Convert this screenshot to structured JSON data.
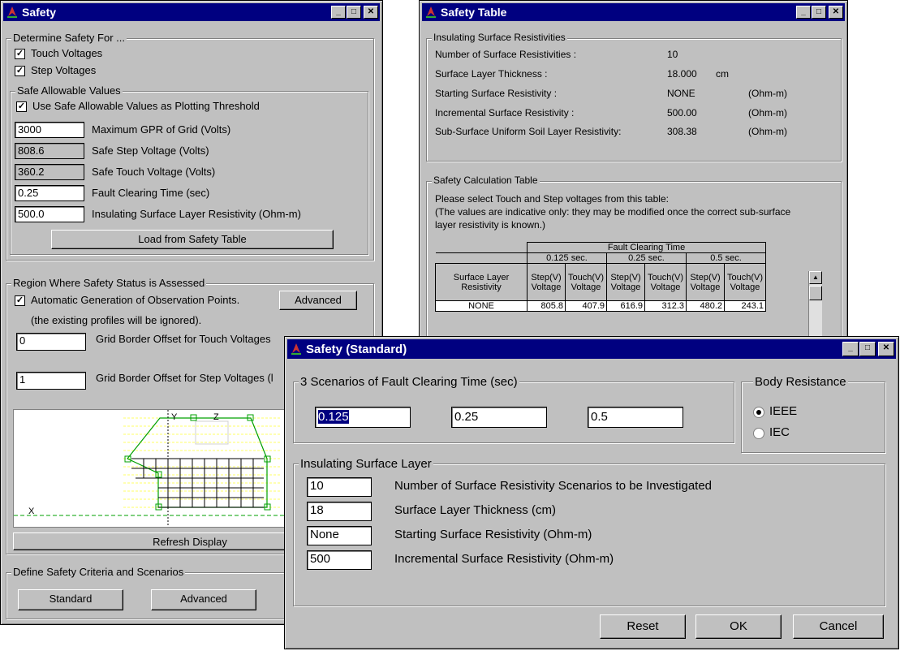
{
  "safety": {
    "title": "Safety",
    "determine": {
      "legend": "Determine Safety For ...",
      "touch_label": "Touch Voltages",
      "step_label": "Step Voltages"
    },
    "allowable": {
      "legend": "Safe Allowable Values",
      "threshold_label": "Use Safe Allowable Values as Plotting Threshold",
      "rows": [
        {
          "value": "3000",
          "label": "Maximum GPR of Grid (Volts)"
        },
        {
          "value": "808.6",
          "label": "Safe Step Voltage (Volts)"
        },
        {
          "value": "360.2",
          "label": "Safe Touch Voltage (Volts)"
        },
        {
          "value": "0.25",
          "label": "Fault Clearing Time (sec)"
        },
        {
          "value": "500.0",
          "label": "Insulating Surface Layer Resistivity (Ohm-m)"
        }
      ],
      "load_button": "Load from Safety Table"
    },
    "region": {
      "legend": "Region Where Safety Status is Assessed",
      "auto_label": "Automatic Generation of Observation Points.",
      "note": "(the existing profiles will be ignored).",
      "advanced_button": "Advanced",
      "touch_offset_value": "0",
      "touch_offset_label": "Grid Border Offset for Touch Voltages",
      "step_offset_value": "1",
      "step_offset_label": "Grid Border Offset for Step Voltages  (l",
      "refresh_button": "Refresh Display"
    },
    "plot": {
      "y_label": "Y",
      "z_label": "Z",
      "x_label": "X"
    },
    "criteria": {
      "legend": "Define Safety Criteria and Scenarios",
      "standard_button": "Standard",
      "advanced_button": "Advanced"
    }
  },
  "table": {
    "title": "Safety Table",
    "insulating": {
      "legend": "Insulating Surface Resistivities",
      "rows": [
        {
          "label": "Number of Surface Resistivities :",
          "value": "10",
          "unit": ""
        },
        {
          "label": "Surface Layer Thickness :",
          "value": "18.000",
          "unit": "cm"
        },
        {
          "label": "Starting Surface Resistivity :",
          "value": "NONE",
          "unit": "(Ohm-m)"
        },
        {
          "label": "Incremental Surface Resistivity :",
          "value": "500.00",
          "unit": "(Ohm-m)"
        },
        {
          "label": "Sub-Surface Uniform Soil Layer Resistivity:",
          "value": "308.38",
          "unit": "(Ohm-m)"
        }
      ]
    },
    "calc": {
      "legend": "Safety Calculation Table",
      "instructions": [
        "Please select Touch and Step voltages from this table:",
        "(The values are indicative only: they may be modified once the correct sub-surface",
        "layer resistivity is known.)"
      ],
      "fault_header": "Fault Clearing Time",
      "times": [
        "0.125 sec.",
        "0.25 sec.",
        "0.5 sec."
      ],
      "row_header": "Surface Layer Resistivity",
      "col_headers": [
        "Step(V) Voltage",
        "Touch(V) Voltage",
        "Step(V) Voltage",
        "Touch(V) Voltage",
        "Step(V) Voltage",
        "Touch(V) Voltage"
      ],
      "row": {
        "label": "NONE",
        "values": [
          "805.8",
          "407.9",
          "616.9",
          "312.3",
          "480.2",
          "243.1"
        ]
      }
    }
  },
  "standard": {
    "title": "Safety (Standard)",
    "scenarios": {
      "legend": "3 Scenarios of  Fault Clearing Time (sec)",
      "values": [
        "0.125",
        "0.25",
        "0.5"
      ]
    },
    "body": {
      "legend": "Body Resistance",
      "options": [
        "IEEE",
        "IEC"
      ],
      "selected": "IEEE"
    },
    "surface": {
      "legend": "Insulating Surface Layer",
      "rows": [
        {
          "value": "10",
          "label": "Number of Surface Resistivity Scenarios to be Investigated"
        },
        {
          "value": "18",
          "label": "Surface Layer Thickness (cm)"
        },
        {
          "value": "None",
          "label": "Starting Surface Resistivity (Ohm-m)"
        },
        {
          "value": "500",
          "label": "Incremental Surface Resistivity (Ohm-m)"
        }
      ]
    },
    "buttons": {
      "reset": "Reset",
      "ok": "OK",
      "cancel": "Cancel"
    }
  },
  "colors": {
    "titlebar": "#000080",
    "face": "#c0c0c0",
    "plot_grid": "#ffff66",
    "plot_outline": "#00a000"
  }
}
